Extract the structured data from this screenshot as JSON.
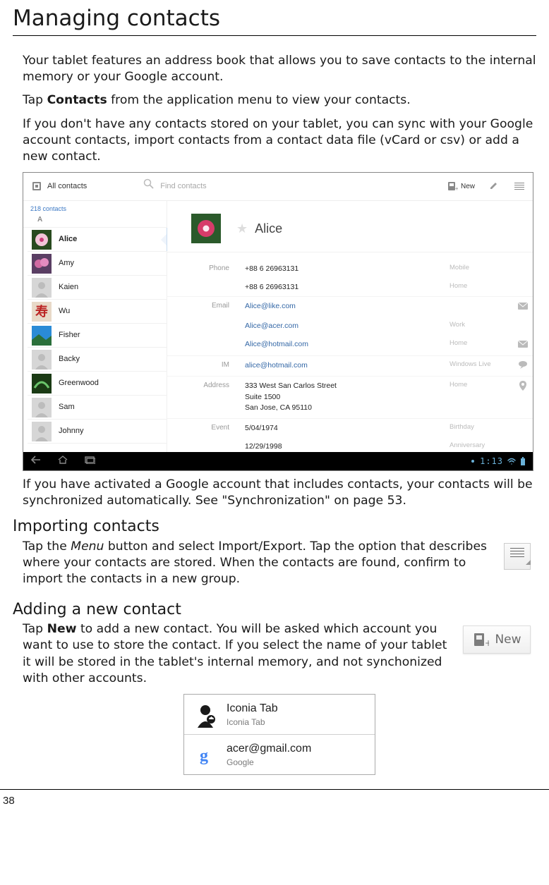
{
  "page": {
    "title": "Managing contacts",
    "number": "38"
  },
  "intro": {
    "p1": "Your tablet features an address book that allows you to save contacts to the internal memory or your Google account.",
    "p2_pre": "Tap ",
    "p2_bold": "Contacts",
    "p2_post": " from the application menu to view your contacts.",
    "p3": "If you don't have any contacts stored on your tablet, you can sync with your Google account contacts, import contacts from a contact data file (vCard or csv) or add a new contact."
  },
  "screenshot1": {
    "toolbar": {
      "source_label": "All contacts",
      "search_placeholder": "Find contacts",
      "new_label": "New"
    },
    "contact_count": "218 contacts",
    "section_letter": "A",
    "contacts": [
      {
        "name": "Alice",
        "thumb": "flower1",
        "selected": true
      },
      {
        "name": "Amy",
        "thumb": "flower2"
      },
      {
        "name": "Kaien",
        "thumb": "placeholder"
      },
      {
        "name": "Wu",
        "thumb": "ideogram"
      },
      {
        "name": "Fisher",
        "thumb": "landscape"
      },
      {
        "name": "Backy",
        "thumb": "placeholder"
      },
      {
        "name": "Greenwood",
        "thumb": "leaves"
      },
      {
        "name": "Sam",
        "thumb": "placeholder"
      },
      {
        "name": "Johnny",
        "thumb": "placeholder"
      }
    ],
    "selected_contact": {
      "name": "Alice",
      "details": [
        {
          "label": "Phone",
          "value": "+88 6 26963131",
          "type": "Mobile",
          "action": ""
        },
        {
          "label": "",
          "value": "+88 6 26963131",
          "type": "Home",
          "action": ""
        },
        {
          "label": "Email",
          "value": "Alice@like.com",
          "type": "",
          "action": "mail"
        },
        {
          "label": "",
          "value": "Alice@acer.com",
          "type": "Work",
          "action": ""
        },
        {
          "label": "",
          "value": "Alice@hotmail.com",
          "type": "Home",
          "action": "mail"
        },
        {
          "label": "IM",
          "value": "alice@hotmail.com",
          "type": "Windows Live",
          "action": "chat"
        },
        {
          "label": "Address",
          "value": "333 West San Carlos Street\nSuite 1500\nSan Jose, CA 95110",
          "type": "Home",
          "action": "pin"
        },
        {
          "label": "Event",
          "value": "5/04/1974",
          "type": "Birthday",
          "action": ""
        },
        {
          "label": "",
          "value": "12/29/1998",
          "type": "Anniversary",
          "action": ""
        }
      ]
    },
    "nav_time": "1:13"
  },
  "after_screenshot": {
    "p1": "If you have activated a Google account that includes contacts, your contacts will be synchronized automatically. See \"Synchronization\" on page 53."
  },
  "importing": {
    "heading": "Importing contacts",
    "p1_pre": "Tap the ",
    "p1_italic": "Menu",
    "p1_post": " button and select Import/Export. Tap the option that describes where your contacts are stored. When the contacts are found, confirm to import the contacts in a new group."
  },
  "adding": {
    "heading": "Adding a new contact",
    "p1_pre": "Tap ",
    "p1_bold": "New",
    "p1_post": " to add a new contact. You will be asked which account you want to use to store the contact. If you select the name of your tablet it will be stored in the tablet's internal memory, and not synchonized with other accounts.",
    "new_button_label": "New"
  },
  "account_dialog": {
    "accounts": [
      {
        "title": "Iconia Tab",
        "subtitle": "Iconia Tab",
        "icon": "profile"
      },
      {
        "title": "acer@gmail.com",
        "subtitle": "Google",
        "icon": "google"
      }
    ]
  }
}
